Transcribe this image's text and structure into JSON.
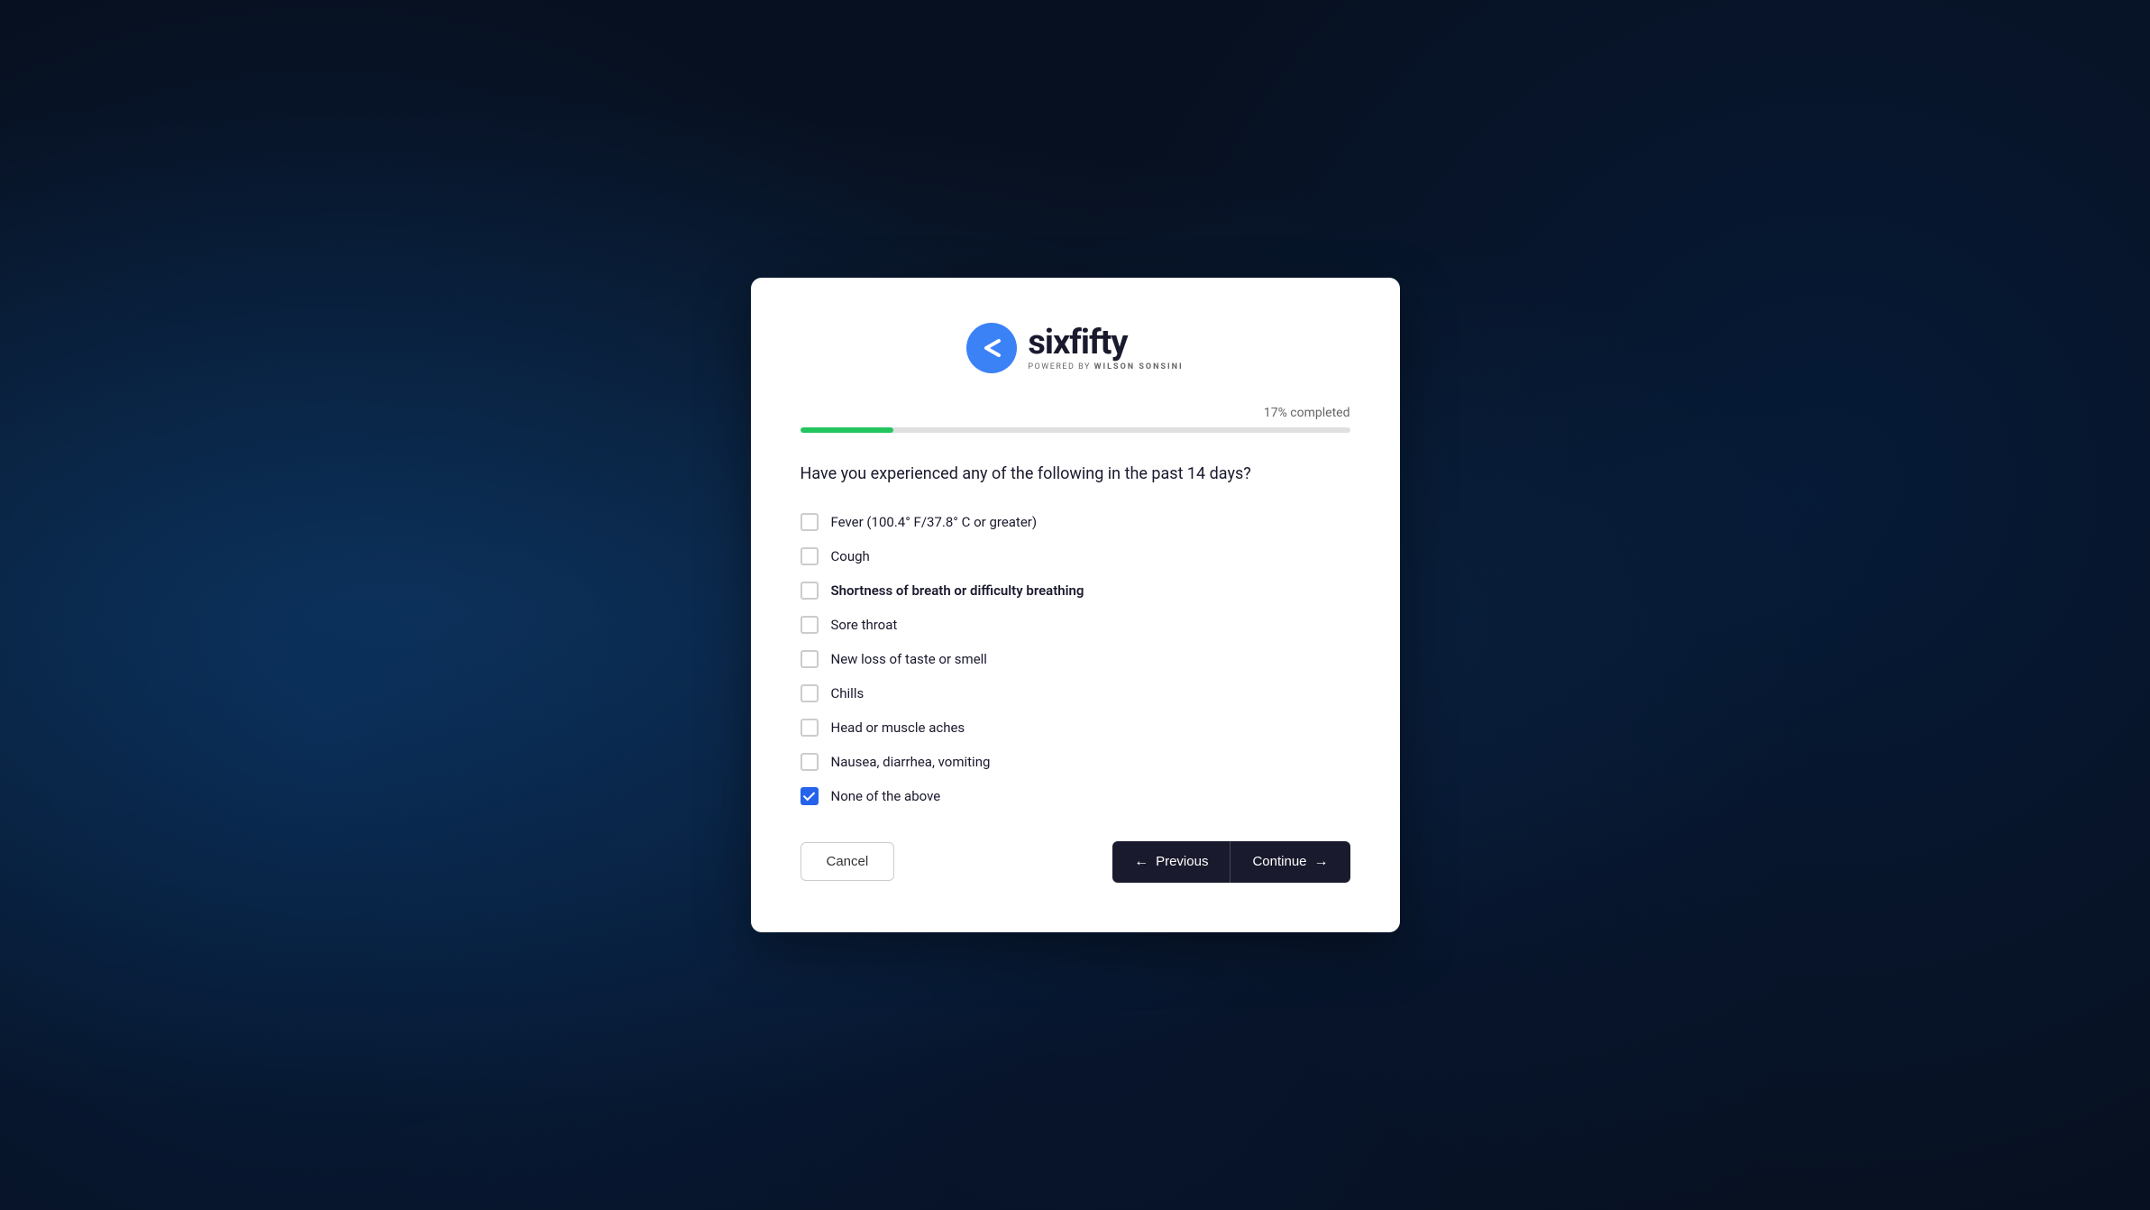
{
  "logo": {
    "brand": "sixfifty",
    "powered_by": "POWERED BY",
    "partner": "WILSON SONSINI"
  },
  "progress": {
    "percentage": 17,
    "label": "17% completed",
    "fill_width": "17%"
  },
  "question": {
    "text": "Have you experienced any of the following in the past 14 days?"
  },
  "options": [
    {
      "id": "fever",
      "label": "Fever (100.4° F/37.8° C or greater)",
      "checked": false,
      "bold": false
    },
    {
      "id": "cough",
      "label": "Cough",
      "checked": false,
      "bold": false
    },
    {
      "id": "shortness",
      "label": "Shortness of breath or difficulty breathing",
      "checked": false,
      "bold": true
    },
    {
      "id": "sore_throat",
      "label": "Sore throat",
      "checked": false,
      "bold": false
    },
    {
      "id": "taste_smell",
      "label": "New loss of taste or smell",
      "checked": false,
      "bold": false
    },
    {
      "id": "chills",
      "label": "Chills",
      "checked": false,
      "bold": false
    },
    {
      "id": "head_muscle",
      "label": "Head or muscle aches",
      "checked": false,
      "bold": false
    },
    {
      "id": "nausea",
      "label": "Nausea, diarrhea, vomiting",
      "checked": false,
      "bold": false
    },
    {
      "id": "none",
      "label": "None of the above",
      "checked": true,
      "bold": false
    }
  ],
  "buttons": {
    "cancel": "Cancel",
    "previous": "Previous",
    "continue": "Continue"
  }
}
